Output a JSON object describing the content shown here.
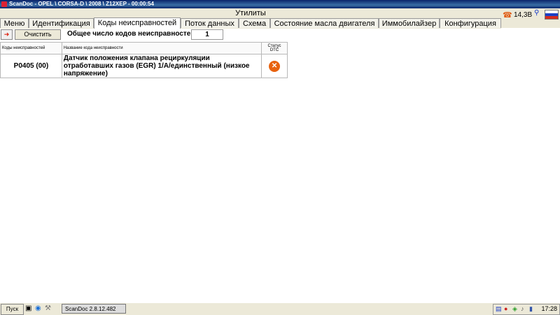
{
  "window": {
    "title": "ScanDoc - OPEL \\ CORSA-D \\ 2008 \\ Z12XEP - 00:00:54"
  },
  "header": {
    "title": "Утилиты"
  },
  "status": {
    "voltage": "14,3В",
    "phone_icon": "phone-icon",
    "usb_icon": "usb-icon",
    "flag_icon": "russian-flag-icon"
  },
  "tabs": [
    {
      "label": "Меню"
    },
    {
      "label": "Идентификация"
    },
    {
      "label": "Коды неисправностей",
      "active": true
    },
    {
      "label": "Поток данных"
    },
    {
      "label": "Схема"
    },
    {
      "label": "Состояние масла двигателя"
    },
    {
      "label": "Иммобилайзер"
    },
    {
      "label": "Конфигурация"
    }
  ],
  "toolbar": {
    "clear_label": "Очистить",
    "count_label": "Общее число кодов неисправностей",
    "count_value": "1"
  },
  "table": {
    "headers": [
      "Коды неисправностей",
      "Название кода неисправности",
      "Статус DTC"
    ],
    "rows": [
      {
        "code": "P0405 (00)",
        "name": "Датчик положения клапана рециркуляции отработавших газов (EGR) 1/A/единственный (низкое напряжение)",
        "status_icon": "error-x-icon"
      }
    ]
  },
  "taskbar": {
    "start_label": "Пуск",
    "task_label": "ScanDoc 2.8.12.482",
    "clock": "17:28"
  },
  "colors": {
    "titlebar": "#0a246a",
    "error": "#e8620f",
    "panel": "#ece9d8"
  }
}
